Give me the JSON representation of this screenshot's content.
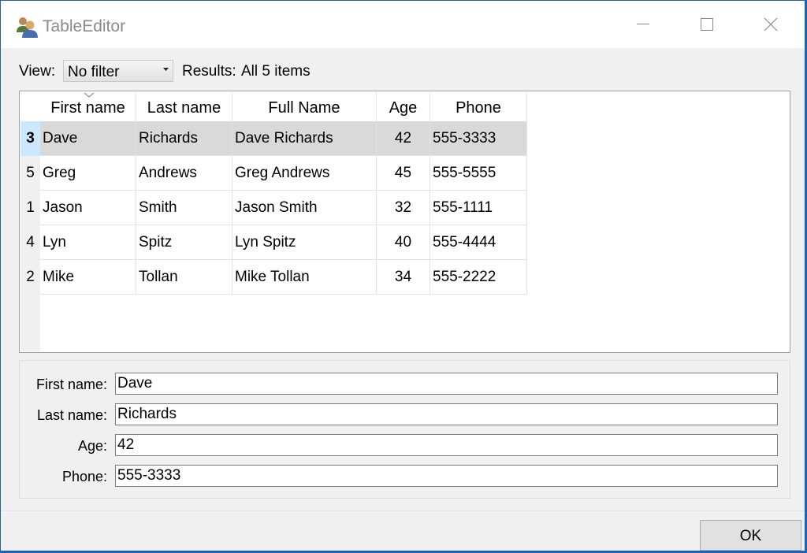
{
  "window": {
    "title": "TableEditor",
    "icon": "users-icon"
  },
  "toolbar": {
    "view_label": "View:",
    "view_value": "No filter",
    "results_label": "Results:",
    "results_value": "All 5 items"
  },
  "table": {
    "columns": [
      "First name",
      "Last name",
      "Full Name",
      "Age",
      "Phone"
    ],
    "sorted_column": "First name",
    "selected_row": 0,
    "rows": [
      {
        "id": "3",
        "first": "Dave",
        "last": "Richards",
        "full": "Dave Richards",
        "age": "42",
        "phone": "555-3333"
      },
      {
        "id": "5",
        "first": "Greg",
        "last": "Andrews",
        "full": "Greg Andrews",
        "age": "45",
        "phone": "555-5555"
      },
      {
        "id": "1",
        "first": "Jason",
        "last": "Smith",
        "full": "Jason Smith",
        "age": "32",
        "phone": "555-1111"
      },
      {
        "id": "4",
        "first": "Lyn",
        "last": "Spitz",
        "full": "Lyn Spitz",
        "age": "40",
        "phone": "555-4444"
      },
      {
        "id": "2",
        "first": "Mike",
        "last": "Tollan",
        "full": "Mike Tollan",
        "age": "34",
        "phone": "555-2222"
      }
    ]
  },
  "details": {
    "first_name_label": "First name:",
    "first_name_value": "Dave",
    "last_name_label": "Last name:",
    "last_name_value": "Richards",
    "age_label": "Age:",
    "age_value": "42",
    "phone_label": "Phone:",
    "phone_value": "555-3333"
  },
  "buttons": {
    "ok": "OK"
  },
  "colors": {
    "selected_row": "#d9d9d9",
    "selected_rownum": "#cce8ff",
    "window_border": "#1c62b9"
  }
}
